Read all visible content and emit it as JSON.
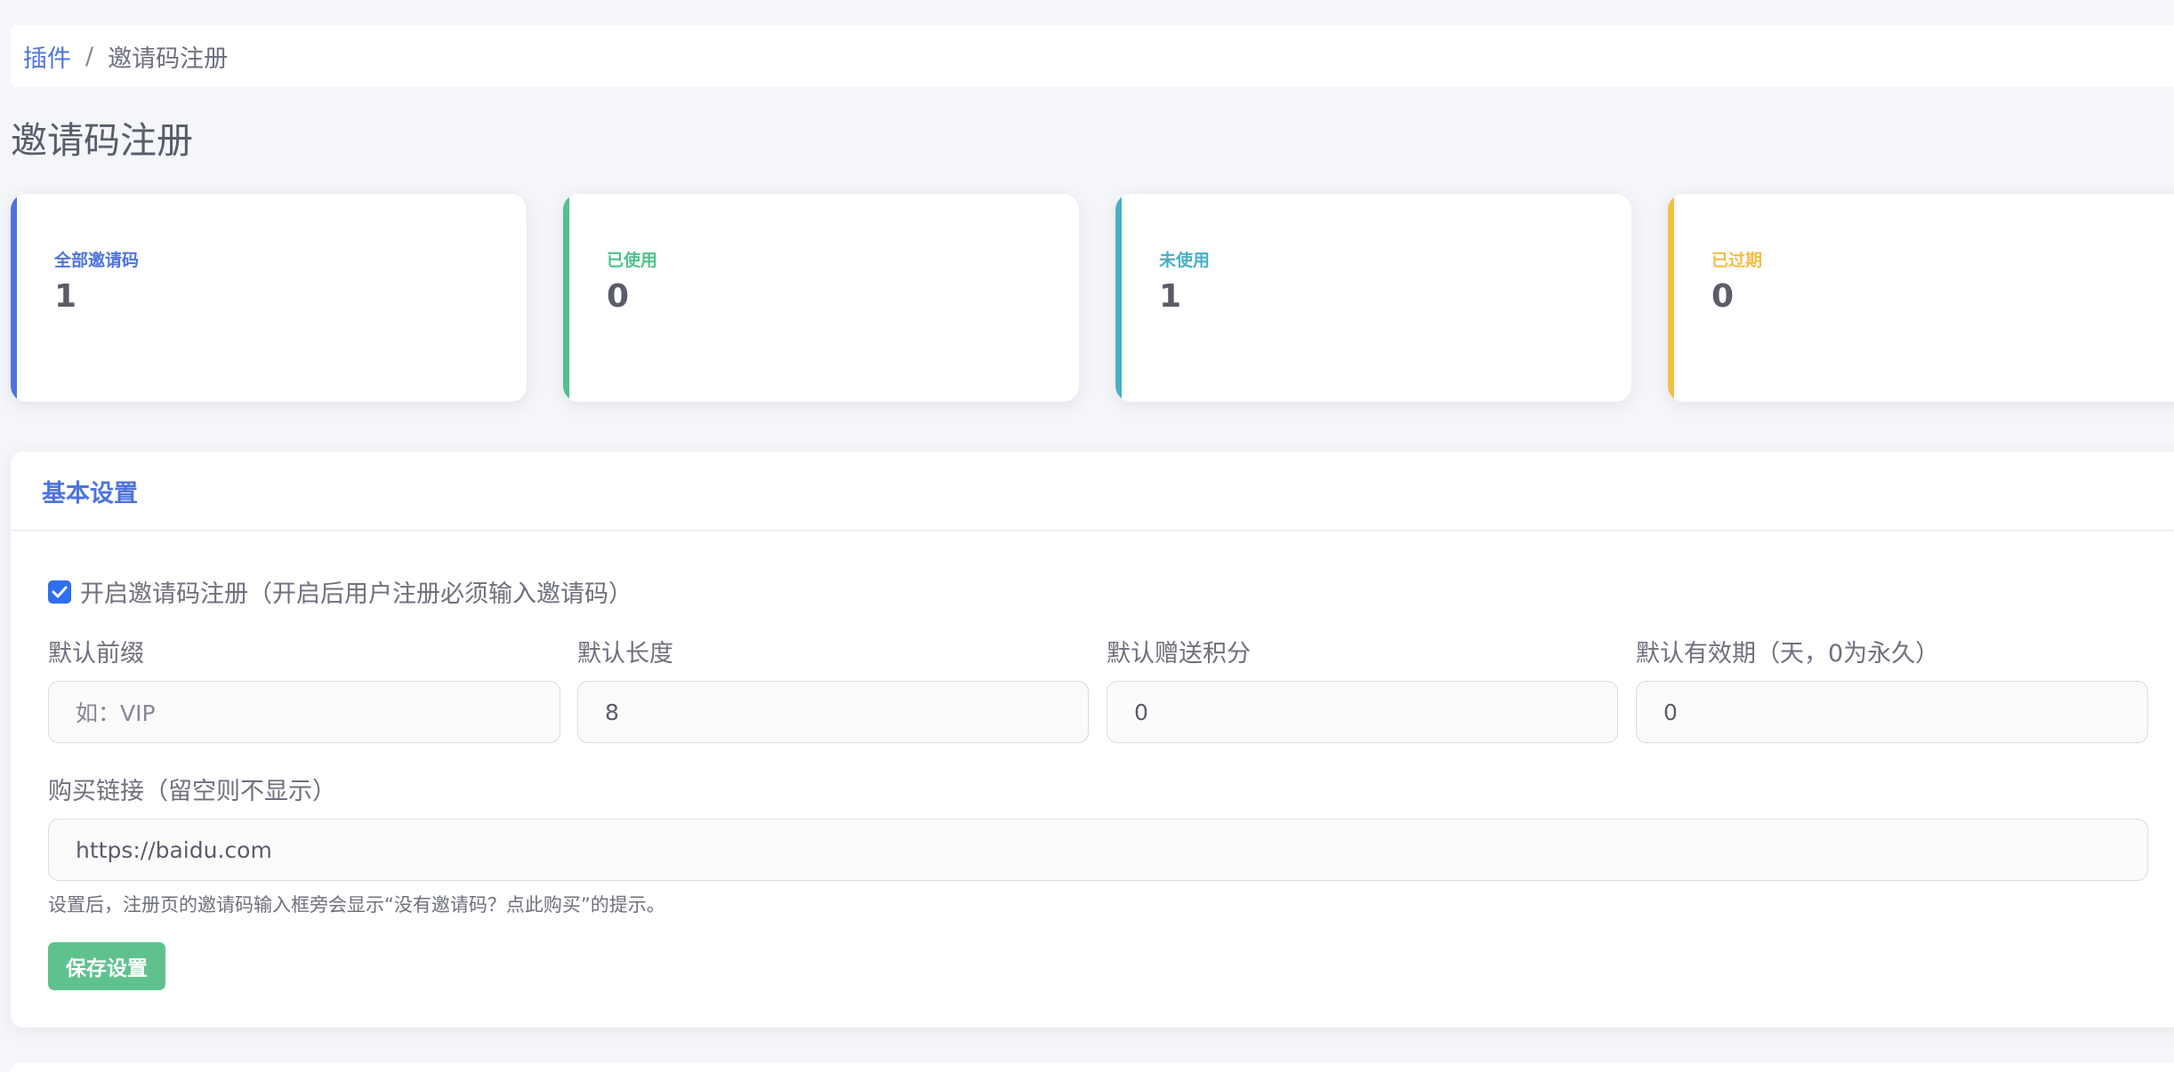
{
  "breadcrumb": {
    "parent": "插件",
    "separator": "/",
    "current": "邀请码注册"
  },
  "page": {
    "title": "邀请码注册"
  },
  "stats": {
    "total": {
      "label": "全部邀请码",
      "value": "1",
      "color": "#4e73df"
    },
    "used": {
      "label": "已使用",
      "value": "0",
      "color": "#4fc28a"
    },
    "unused": {
      "label": "未使用",
      "value": "1",
      "color": "#48b0c4"
    },
    "expired": {
      "label": "已过期",
      "value": "0",
      "color": "#f2be45"
    }
  },
  "settings": {
    "header": "基本设置",
    "enable_checkbox": {
      "label": "开启邀请码注册（开启后用户注册必须输入邀请码）",
      "checked": true
    },
    "prefix": {
      "label": "默认前缀",
      "value": "",
      "placeholder": "如：VIP"
    },
    "length": {
      "label": "默认长度",
      "value": "8"
    },
    "points": {
      "label": "默认赠送积分",
      "value": "0"
    },
    "validity": {
      "label": "默认有效期（天，0为永久）",
      "value": "0"
    },
    "purchase_link": {
      "label": "购买链接（留空则不显示）",
      "value": "https://baidu.com"
    },
    "help_text": "设置后，注册页的邀请码输入框旁会显示“没有邀请码？点此购买”的提示。",
    "save_label": "保存设置"
  }
}
